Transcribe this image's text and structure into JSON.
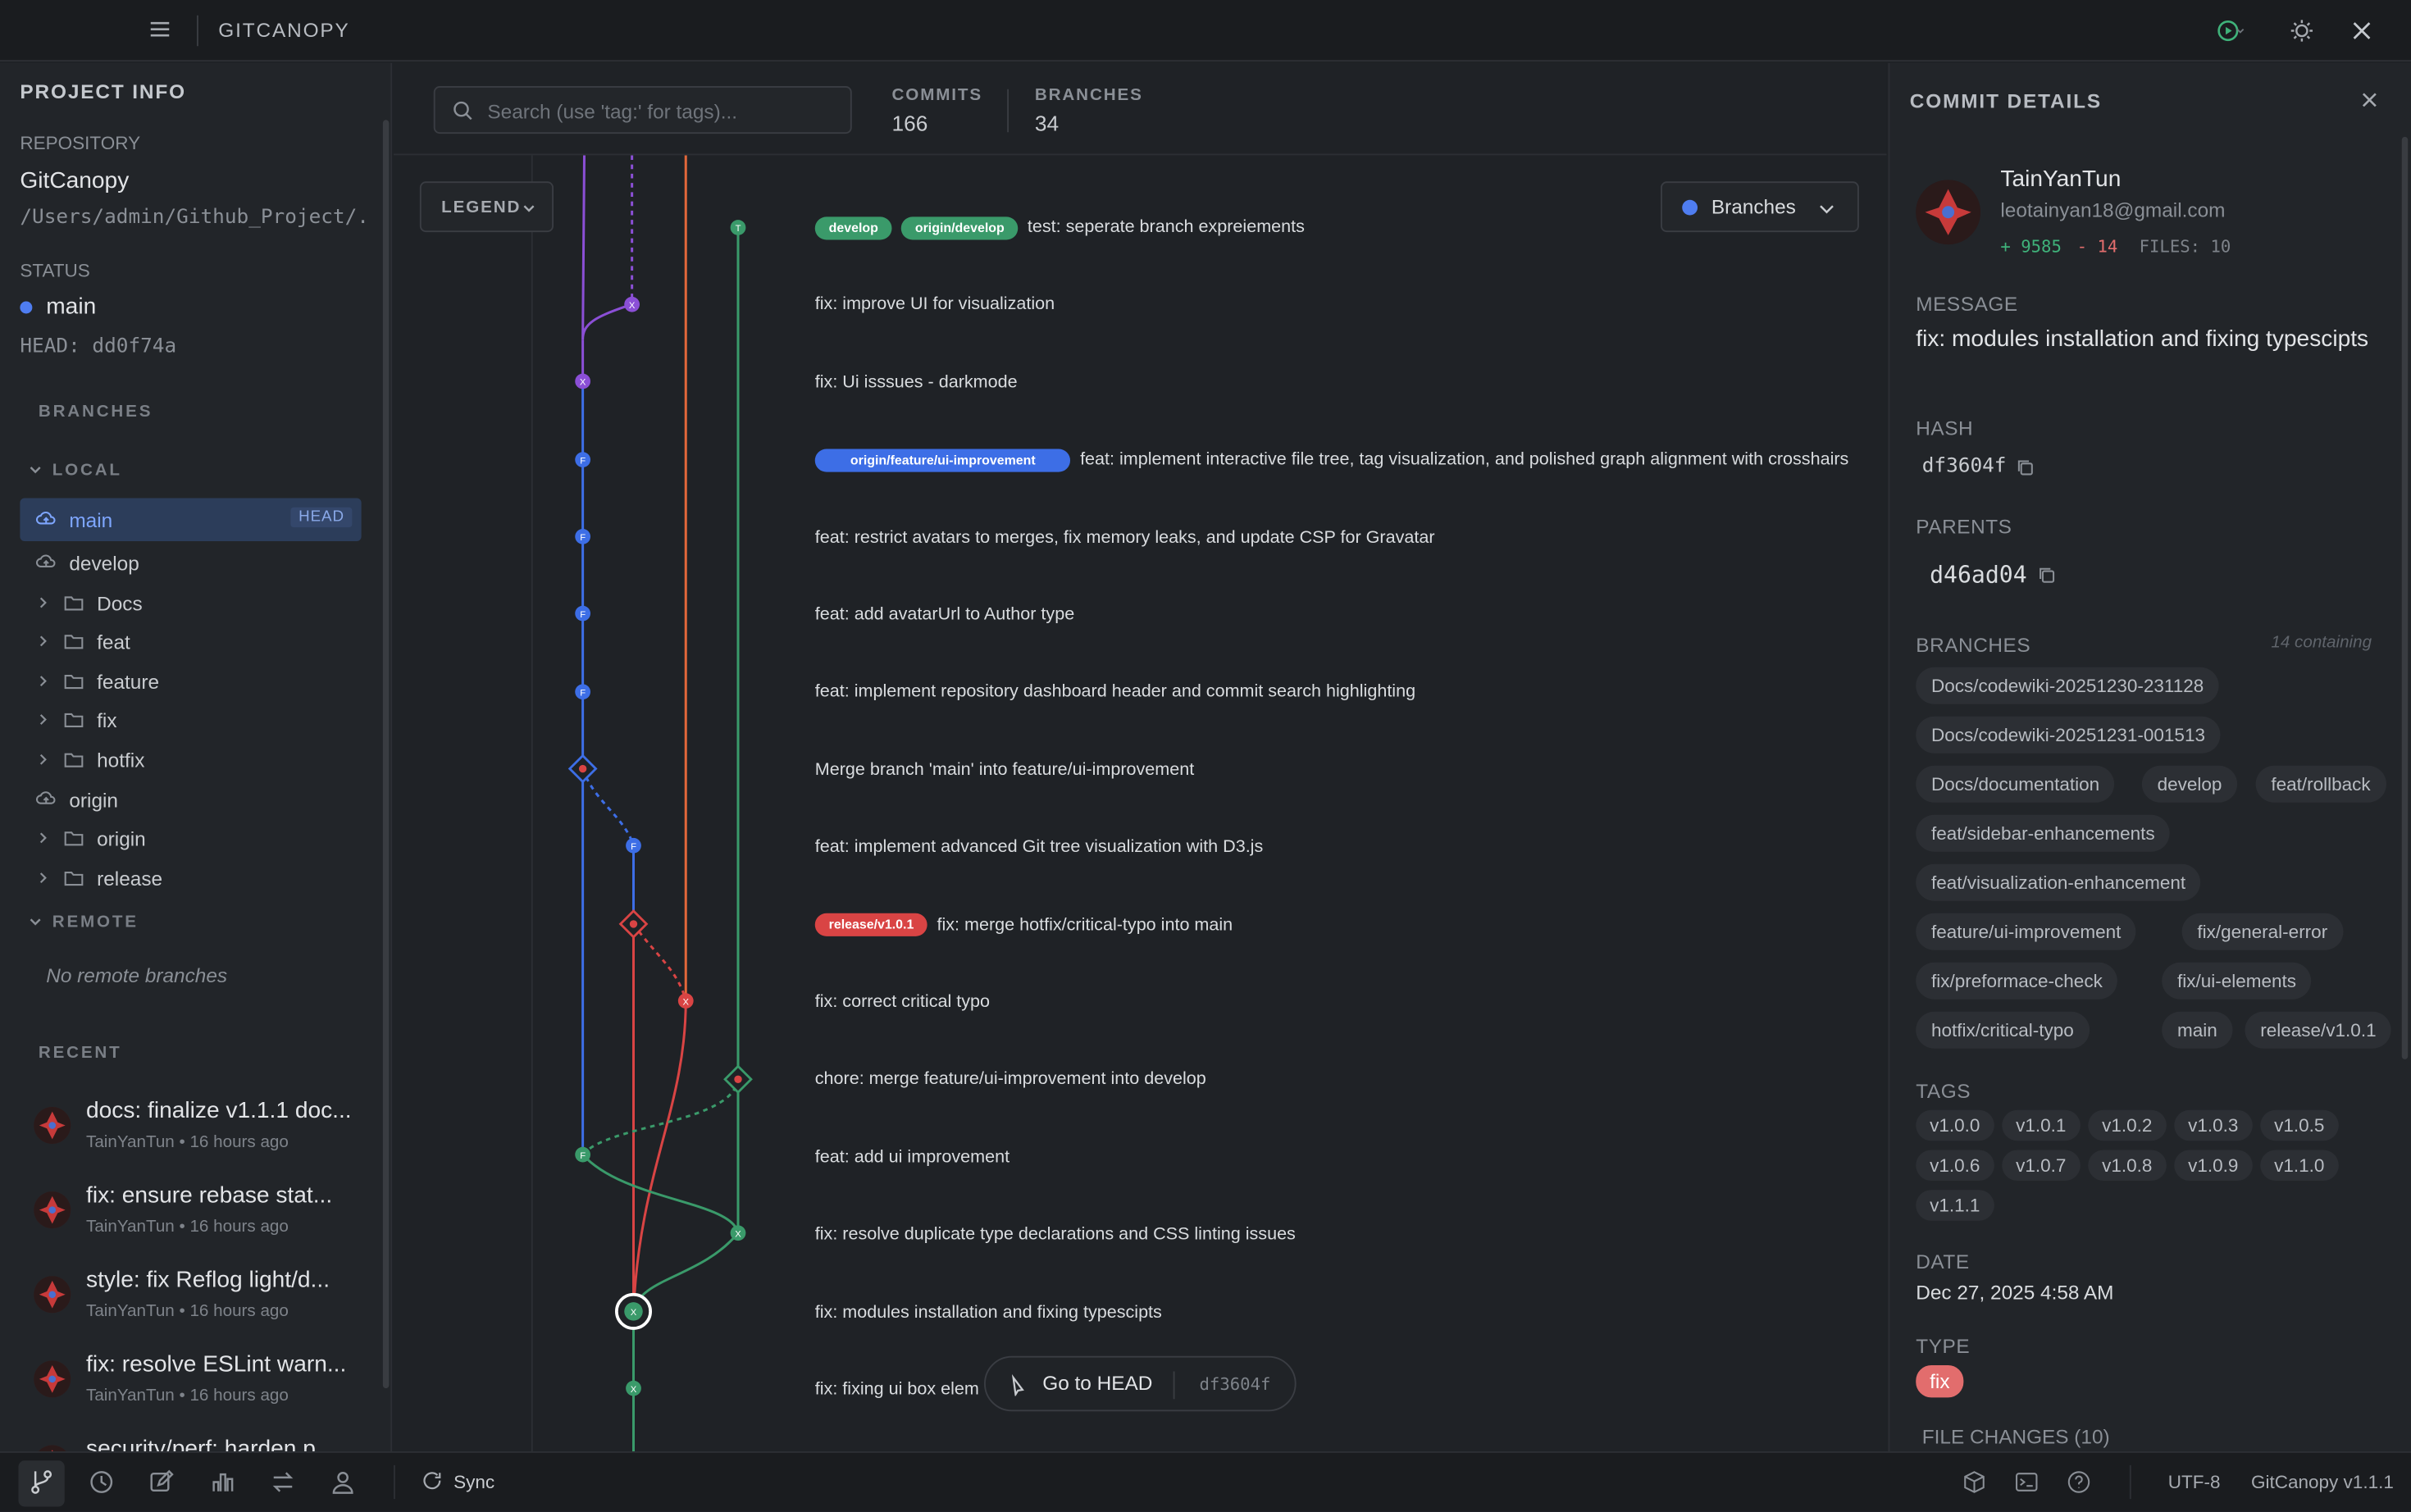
{
  "app": {
    "title": "GITCANOPY",
    "version": "GitCanopy v1.1.1",
    "encoding": "UTF-8"
  },
  "sidebar": {
    "title": "PROJECT INFO",
    "repository_label": "REPOSITORY",
    "repository_name": "GitCanopy",
    "repository_path": "/Users/admin/Github_Project/...",
    "status_label": "STATUS",
    "status_branch": "main",
    "head": "HEAD: dd0f74a",
    "branches_label": "BRANCHES",
    "local_label": "LOCAL",
    "remote_label": "REMOTE",
    "no_remote": "No remote branches",
    "head_badge": "HEAD",
    "local_items": [
      {
        "label": "main",
        "type": "branch",
        "active": true
      },
      {
        "label": "develop",
        "type": "branch"
      },
      {
        "label": "Docs",
        "type": "folder"
      },
      {
        "label": "feat",
        "type": "folder"
      },
      {
        "label": "feature",
        "type": "folder"
      },
      {
        "label": "fix",
        "type": "folder"
      },
      {
        "label": "hotfix",
        "type": "folder"
      },
      {
        "label": "origin",
        "type": "branch"
      },
      {
        "label": "origin",
        "type": "folder"
      },
      {
        "label": "release",
        "type": "folder"
      }
    ],
    "recent_label": "RECENT",
    "recent": [
      {
        "title": "docs: finalize v1.1.1 doc...",
        "meta": "TainYanTun • 16 hours ago"
      },
      {
        "title": "fix: ensure rebase stat...",
        "meta": "TainYanTun • 16 hours ago"
      },
      {
        "title": "style: fix Reflog light/d...",
        "meta": "TainYanTun • 16 hours ago"
      },
      {
        "title": "fix: resolve ESLint warn...",
        "meta": "TainYanTun • 16 hours ago"
      },
      {
        "title": "security/perf: harden p...",
        "meta": ""
      }
    ]
  },
  "main": {
    "search_placeholder": "Search (use 'tag:' for tags)...",
    "commits_label": "COMMITS",
    "commits_value": "166",
    "branches_label": "BRANCHES",
    "branches_value": "34",
    "legend_label": "LEGEND",
    "branches_filter_label": "Branches",
    "goto_head_label": "Go to HEAD",
    "goto_head_hash": "df3604f",
    "commits": [
      {
        "message": "test: seperate branch expreiements",
        "refs": [
          {
            "name": "develop",
            "color": "#3a9a6a"
          },
          {
            "name": "origin/develop",
            "color": "#3a9a6a"
          }
        ]
      },
      {
        "message": "fix: improve UI for visualization",
        "refs": []
      },
      {
        "message": "fix: Ui isssues - darkmode",
        "refs": []
      },
      {
        "message": "feat: implement interactive file tree, tag visualization, and polished graph alignment with crosshairs",
        "refs": [
          {
            "name": "origin/feature/ui-improvement",
            "color": "#3d6ee6"
          }
        ]
      },
      {
        "message": "feat: restrict avatars to merges, fix memory leaks, and update CSP for Gravatar",
        "refs": []
      },
      {
        "message": "feat: add avatarUrl to Author type",
        "refs": []
      },
      {
        "message": "feat: implement repository dashboard header and commit search highlighting",
        "refs": []
      },
      {
        "message": "Merge branch 'main' into feature/ui-improvement",
        "refs": []
      },
      {
        "message": "feat: implement advanced Git tree visualization with D3.js",
        "refs": []
      },
      {
        "message": "fix: merge hotfix/critical-typo into main",
        "refs": [
          {
            "name": "release/v1.0.1",
            "color": "#d94444"
          }
        ]
      },
      {
        "message": "fix: correct critical typo",
        "refs": []
      },
      {
        "message": "chore: merge feature/ui-improvement into develop",
        "refs": []
      },
      {
        "message": "feat: add ui improvement",
        "refs": []
      },
      {
        "message": "fix: resolve duplicate type declarations and CSS linting issues",
        "refs": []
      },
      {
        "message": "fix: modules installation and fixing typescipts",
        "refs": []
      },
      {
        "message": "fix: fixing ui box elem",
        "refs": []
      }
    ],
    "node_letters": [
      "T",
      "X",
      "X",
      "F",
      "F",
      "F",
      "F",
      "F",
      "X",
      "X",
      "X",
      "T"
    ]
  },
  "details": {
    "title": "COMMIT DETAILS",
    "author": "TainYanTun",
    "email": "leotainyan18@gmail.com",
    "additions": "+ 9585",
    "deletions": "- 14",
    "files": "FILES: 10",
    "message_label": "MESSAGE",
    "message": "fix: modules installation and fixing typescipts",
    "hash_label": "HASH",
    "hash": "df3604f",
    "parents_label": "PARENTS",
    "parent": "d46ad04",
    "branches_label": "BRANCHES",
    "branches_containing": "14 containing",
    "branches": [
      "Docs/codewiki-20251230-231128",
      "Docs/codewiki-20251231-001513",
      "Docs/documentation",
      "develop",
      "feat/rollback",
      "feat/sidebar-enhancements",
      "feat/visualization-enhancement",
      "feature/ui-improvement",
      "fix/general-error",
      "fix/preformace-check",
      "fix/ui-elements",
      "hotfix/critical-typo",
      "main",
      "release/v1.0.1"
    ],
    "tags_label": "TAGS",
    "tags": [
      "v1.0.0",
      "v1.0.1",
      "v1.0.2",
      "v1.0.3",
      "v1.0.5",
      "v1.0.6",
      "v1.0.7",
      "v1.0.8",
      "v1.0.9",
      "v1.1.0",
      "v1.1.1"
    ],
    "date_label": "DATE",
    "date": "Dec 27, 2025 4:58 AM",
    "type_label": "TYPE",
    "type": "fix",
    "file_changes": "FILE CHANGES (10)"
  },
  "bottombar": {
    "sync_label": "Sync"
  },
  "colors": {
    "accent": "#4f7df0",
    "green": "#3a9a6a",
    "red": "#d94444",
    "purple": "#8b4fd6",
    "orange": "#e2673a"
  }
}
